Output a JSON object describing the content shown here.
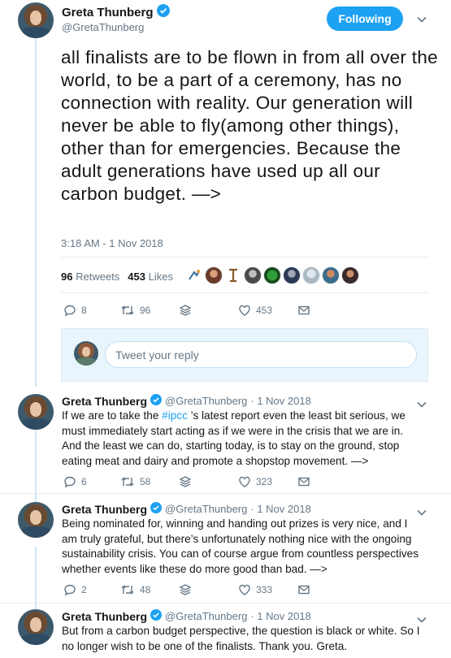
{
  "main_tweet": {
    "author_name": "Greta Thunberg",
    "author_handle": "@GretaThunberg",
    "follow_label": "Following",
    "text": "all finalists are to be flown in from all over the world, to be a part of a ceremony, has no connection with reality. Our generation will never be able to fly(among other things), other than for emergencies. Because the adult generations have used up all our carbon budget.  —>",
    "timestamp": "3:18 AM - 1 Nov 2018",
    "retweets_count": "96",
    "retweets_label": "Retweets",
    "likes_count": "453",
    "likes_label": "Likes",
    "actions": {
      "replies": "8",
      "retweets": "96",
      "likes": "453"
    }
  },
  "reply_box": {
    "placeholder": "Tweet your reply"
  },
  "replies": [
    {
      "author_name": "Greta Thunberg",
      "author_handle": "@GretaThunberg",
      "date": "· 1 Nov 2018",
      "text_before": "If we are to take the ",
      "hashtag": "#ipcc",
      "text_after": " ’s latest report even the least bit serious, we must immediately start acting as if we were in the crisis that we are in. And the least we can do, starting today, is to stay on the ground, stop eating meat and dairy and promote a shopstop movement.  —>",
      "actions": {
        "replies": "6",
        "retweets": "58",
        "likes": "323"
      }
    },
    {
      "author_name": "Greta Thunberg",
      "author_handle": "@GretaThunberg",
      "date": "· 1 Nov 2018",
      "text": "Being nominated for, winning and handing out prizes is very nice, and I am truly grateful, but there’s unfortunately nothing nice with the ongoing sustainability crisis. You can of course argue from countless perspectives whether events like these do more good than bad.  —>",
      "actions": {
        "replies": "2",
        "retweets": "48",
        "likes": "333"
      }
    },
    {
      "author_name": "Greta Thunberg",
      "author_handle": "@GretaThunberg",
      "date": "· 1 Nov 2018",
      "text": "But from a carbon budget perspective, the question is black or white. So I no longer wish to be one of the finalists. Thank you. Greta."
    }
  ],
  "colors": {
    "accent": "#1da1f2",
    "muted": "#657786",
    "thread_line": "#cce6f8"
  }
}
